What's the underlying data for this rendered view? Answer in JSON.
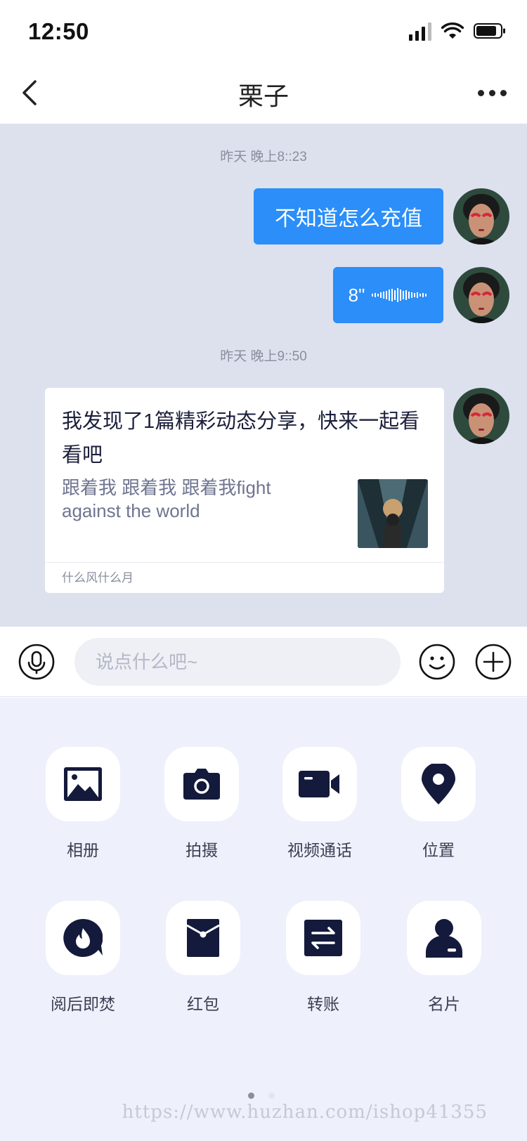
{
  "status_bar": {
    "time": "12:50"
  },
  "nav": {
    "title": "栗子"
  },
  "chat": {
    "timestamps": [
      "昨天 晚上8::23",
      "昨天 晚上9::50"
    ],
    "messages": [
      {
        "type": "text",
        "text": "不知道怎么充值"
      },
      {
        "type": "voice",
        "duration": "8\""
      },
      {
        "type": "share",
        "title": "我发现了1篇精彩动态分享，快来一起看看吧",
        "description": "跟着我 跟着我 跟着我fight against the world",
        "source": "什么风什么月"
      }
    ]
  },
  "input": {
    "placeholder": "说点什么吧~"
  },
  "actions": [
    {
      "label": "相册",
      "icon": "album-icon"
    },
    {
      "label": "拍摄",
      "icon": "camera-icon"
    },
    {
      "label": "视频通话",
      "icon": "video-call-icon"
    },
    {
      "label": "位置",
      "icon": "location-icon"
    },
    {
      "label": "阅后即焚",
      "icon": "burn-after-read-icon"
    },
    {
      "label": "红包",
      "icon": "red-packet-icon"
    },
    {
      "label": "转账",
      "icon": "transfer-icon"
    },
    {
      "label": "名片",
      "icon": "contact-card-icon"
    }
  ],
  "pager": {
    "pages": 2,
    "current": 1
  },
  "watermark": "https://www.huzhan.com/ishop41355",
  "colors": {
    "accent": "#2b8ef9",
    "chat_bg": "#dde1ee",
    "panel_bg": "#eef1fb",
    "icon_dark": "#141a3c"
  }
}
